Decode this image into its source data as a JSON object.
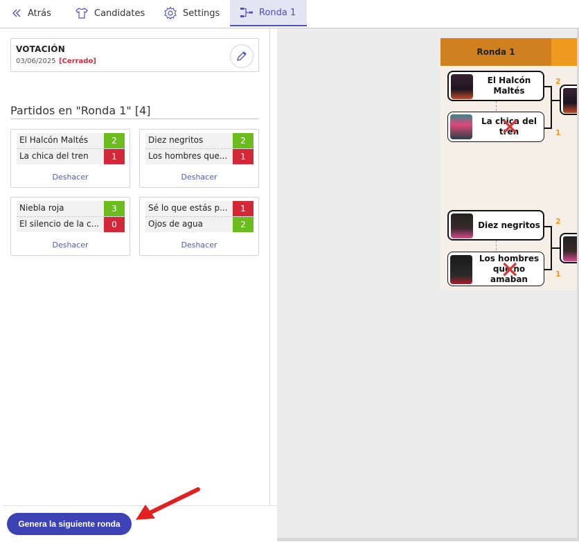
{
  "nav": {
    "back_label": "Atrás",
    "candidates_label": "Candidates",
    "settings_label": "Settings",
    "round_label": "Ronda 1"
  },
  "votacion": {
    "title": "VOTACIÓN",
    "date": "03/06/2025",
    "status": "[Cerrado]"
  },
  "section_title": "Partidos en \"Ronda 1\" [4]",
  "matches": [
    {
      "team1": "El Halcón Maltés",
      "score1": "2",
      "team2": "La chica del tren",
      "score2": "1",
      "undo": "Deshacer"
    },
    {
      "team1": "Diez negritos",
      "score1": "2",
      "team2": "Los hombres que...",
      "score2": "1",
      "undo": "Deshacer"
    },
    {
      "team1": "Niebla roja",
      "score1": "3",
      "team2": "El silencio de la c...",
      "score2": "0",
      "undo": "Deshacer"
    },
    {
      "team1": "Sé lo que estás p...",
      "score1": "1",
      "team2": "Ojos de agua",
      "score2": "2",
      "undo": "Deshacer"
    }
  ],
  "next_round_button": "Genera la siguiente ronda",
  "bracket": {
    "round_header": "Ronda 1",
    "games": [
      {
        "team1": "El Halcón Maltés",
        "team2": "La chica del tren",
        "seed1": "2",
        "seed2": "1"
      },
      {
        "team1": "Diez negritos",
        "team2": "Los hombres que no amaban",
        "seed1": "2",
        "seed2": "1"
      }
    ]
  },
  "colors": {
    "accent": "#3d43b5",
    "win": "#6bbd1e",
    "lose": "#d32838",
    "round_header": "#d0801e",
    "arrow": "#e32020"
  }
}
